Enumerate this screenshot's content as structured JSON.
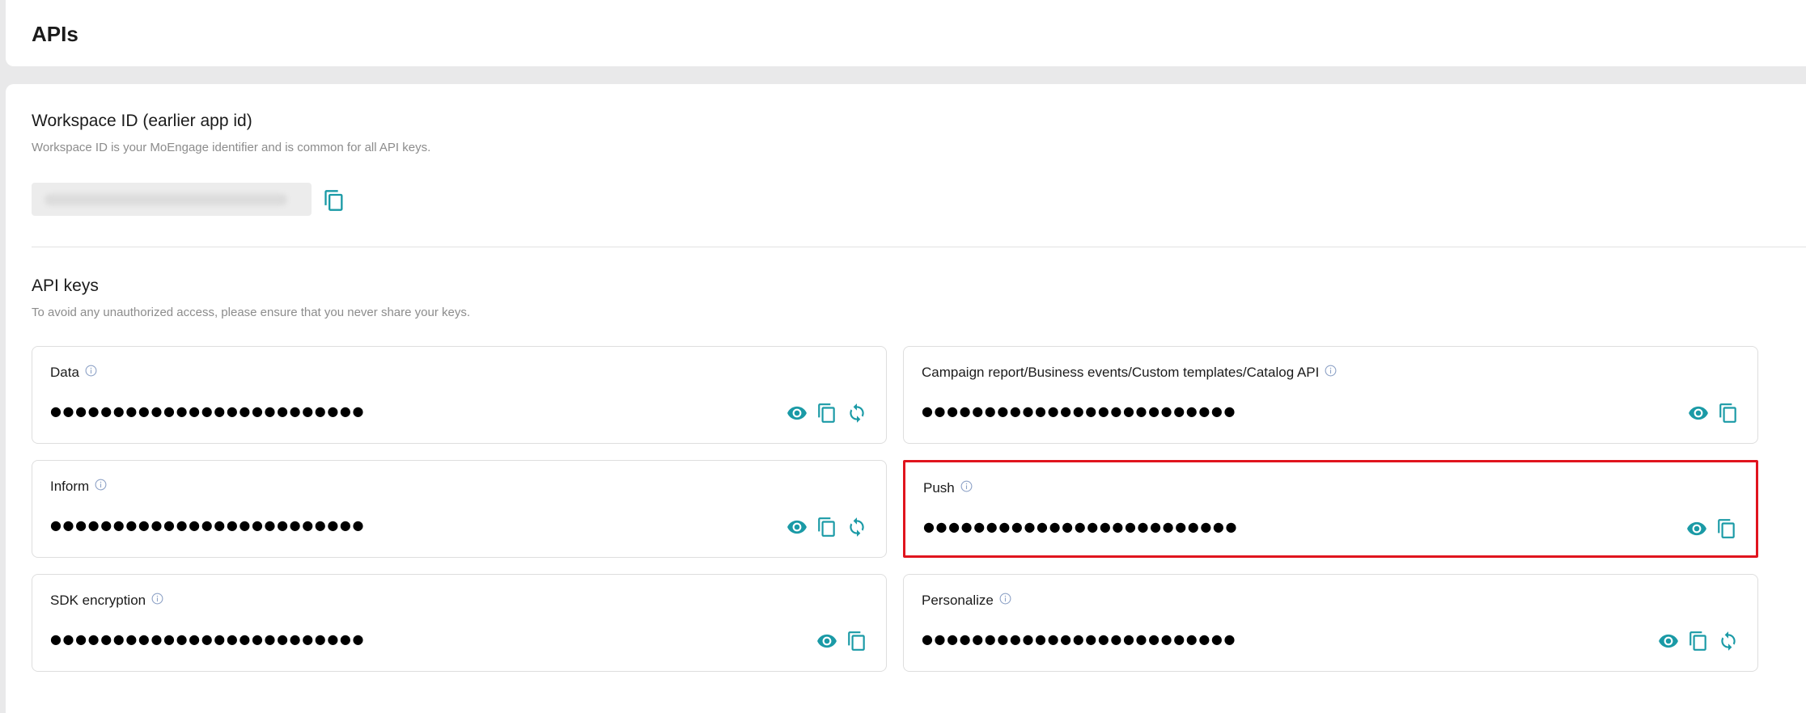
{
  "header": {
    "title": "APIs"
  },
  "workspace": {
    "title": "Workspace ID (earlier app id)",
    "description": "Workspace ID is your MoEngage identifier and is common for all API keys."
  },
  "api_keys": {
    "title": "API keys",
    "description": "To avoid any unauthorized access, please ensure that you never share your keys.",
    "cards": [
      {
        "label": "Data",
        "masked": "●●●●●●●●●●●●●●●●●●●●●●●●●",
        "actions": [
          "show-icon",
          "copy-icon",
          "regenerate-icon"
        ],
        "highlighted": false
      },
      {
        "label": "Campaign report/Business events/Custom templates/Catalog API",
        "masked": "●●●●●●●●●●●●●●●●●●●●●●●●●",
        "actions": [
          "show-icon",
          "copy-icon"
        ],
        "highlighted": false
      },
      {
        "label": "Inform",
        "masked": "●●●●●●●●●●●●●●●●●●●●●●●●●",
        "actions": [
          "show-icon",
          "copy-icon",
          "regenerate-icon"
        ],
        "highlighted": false
      },
      {
        "label": "Push",
        "masked": "●●●●●●●●●●●●●●●●●●●●●●●●●",
        "actions": [
          "show-icon",
          "copy-icon"
        ],
        "highlighted": true
      },
      {
        "label": "SDK encryption",
        "masked": "●●●●●●●●●●●●●●●●●●●●●●●●●",
        "actions": [
          "show-icon",
          "copy-icon"
        ],
        "highlighted": false
      },
      {
        "label": "Personalize",
        "masked": "●●●●●●●●●●●●●●●●●●●●●●●●●",
        "actions": [
          "show-icon",
          "copy-icon",
          "regenerate-icon"
        ],
        "highlighted": false
      }
    ]
  },
  "colors": {
    "accent": "#1a9aa6",
    "highlight": "#e0141e",
    "info": "#8fa3c7"
  }
}
